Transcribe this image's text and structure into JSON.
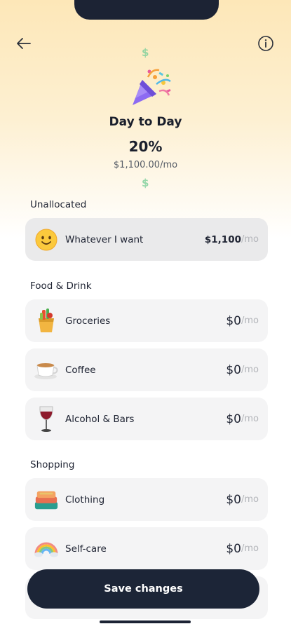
{
  "header": {
    "back_icon": "arrow-left-icon",
    "info_icon": "info-circle-icon"
  },
  "hero": {
    "title": "Day to Day",
    "percent": "20%",
    "amount": "$1,100.00/mo",
    "icon": "party-popper-icon",
    "decor_symbol": "$"
  },
  "sections": [
    {
      "label": "Unallocated",
      "items": [
        {
          "name": "Whatever I want",
          "icon": "smiley-face-icon",
          "value": "$1,100",
          "suffix": "/mo"
        }
      ]
    },
    {
      "label": "Food & Drink",
      "items": [
        {
          "name": "Groceries",
          "icon": "grocery-bag-icon",
          "value": "$0",
          "suffix": "/mo"
        },
        {
          "name": "Coffee",
          "icon": "coffee-cup-icon",
          "value": "$0",
          "suffix": "/mo"
        },
        {
          "name": "Alcohol & Bars",
          "icon": "wine-glass-icon",
          "value": "$0",
          "suffix": "/mo"
        }
      ]
    },
    {
      "label": "Shopping",
      "items": [
        {
          "name": "Clothing",
          "icon": "clothes-stack-icon",
          "value": "$0",
          "suffix": "/mo"
        },
        {
          "name": "Self-care",
          "icon": "rainbow-icon",
          "value": "$0",
          "suffix": "/mo"
        }
      ]
    }
  ],
  "footer": {
    "save_label": "Save changes"
  },
  "colors": {
    "accent_dark": "#1c2537",
    "card_bg": "#f4f4f5",
    "gradient_top": "#fde7b8",
    "dollar_green": "#7ccf9a"
  }
}
